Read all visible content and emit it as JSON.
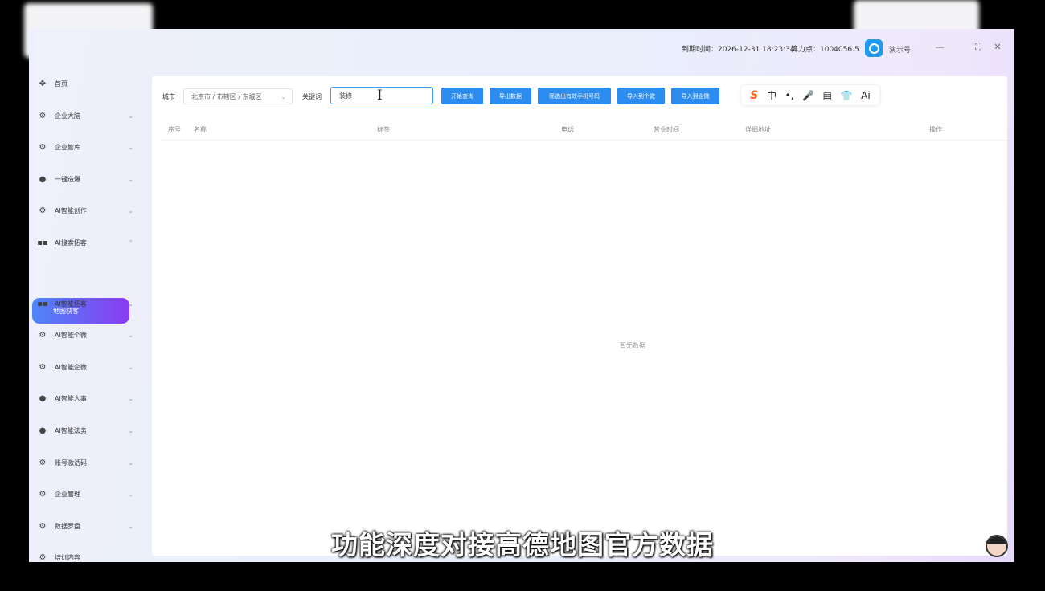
{
  "header": {
    "expire_text": "到期时间：2026-12-31 18:23:34",
    "power_text": "算力点：1004056.5",
    "username": "演示号",
    "win_controls": [
      "—",
      "⛶",
      "✕"
    ]
  },
  "sidebar": {
    "items": [
      {
        "label": "首页",
        "icon": "home-icon"
      },
      {
        "label": "企业大脑",
        "icon": "gear-icon"
      },
      {
        "label": "企业智库",
        "icon": "gear-icon"
      },
      {
        "label": "一键造爆",
        "icon": "user-icon"
      },
      {
        "label": "AI智能创作",
        "icon": "gear-icon"
      },
      {
        "label": "AI搜索拓客",
        "icon": "grid-icon"
      },
      {
        "label": "地图获客",
        "icon": ""
      },
      {
        "label": "AI智能拓客",
        "icon": "grid-icon"
      },
      {
        "label": "AI智能个微",
        "icon": "gear-icon"
      },
      {
        "label": "AI智能企微",
        "icon": "gear-icon"
      },
      {
        "label": "AI智能人事",
        "icon": "user-icon"
      },
      {
        "label": "AI智能法务",
        "icon": "user-icon"
      },
      {
        "label": "账号激活码",
        "icon": "gear-icon"
      },
      {
        "label": "企业管理",
        "icon": "gear-icon"
      },
      {
        "label": "数据罗盘",
        "icon": "gear-icon"
      },
      {
        "label": "培训内容",
        "icon": "gear-icon"
      }
    ]
  },
  "search": {
    "city_label": "城市",
    "city_value": "北京市 / 市辖区 / 东城区",
    "keyword_label": "关键词",
    "keyword_value": "装修"
  },
  "buttons": {
    "start": "开始查询",
    "export": "导出数据",
    "filter_mobile": "筛选出有效手机号码",
    "import_personal": "导入到个微",
    "import_enterprise": "导入到企微"
  },
  "ime": {
    "items": [
      "S",
      "中",
      "•,",
      "🎤",
      "▤",
      "👕",
      "Ai"
    ]
  },
  "table": {
    "headers": [
      "序号",
      "名称",
      "标签",
      "电话",
      "营业时间",
      "详细地址",
      "操作"
    ],
    "empty_text": "暂无数据"
  },
  "subtitle": "功能深度对接高德地图官方数据"
}
